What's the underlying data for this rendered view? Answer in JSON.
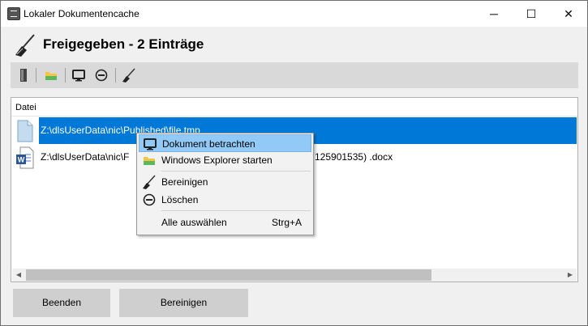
{
  "window": {
    "title": "Lokaler Dokumentencache",
    "minimize_glyph": "─",
    "maximize_glyph": "☐",
    "close_glyph": "✕"
  },
  "heading": {
    "text": "Freigegeben - 2 Einträge",
    "icon": "broom-icon"
  },
  "toolbar": {
    "icons": [
      "exit-door-icon",
      "folder-icon",
      "monitor-icon",
      "remove-circle-icon",
      "broom-icon"
    ]
  },
  "list": {
    "column_header": "Datei",
    "rows": [
      {
        "path": "Z:\\dlsUserData\\nic\\Published\\file.tmp",
        "icon": "generic-file-icon",
        "selected": true
      },
      {
        "path_start": "Z:\\dlsUserData\\nic\\F",
        "path_end": "125901535) .docx",
        "icon": "word-document-icon",
        "selected": false
      }
    ],
    "scroll_left_glyph": "◀",
    "scroll_right_glyph": "▶"
  },
  "buttons": {
    "exit_label": "Beenden",
    "clean_label": "Bereinigen"
  },
  "context_menu": {
    "items": [
      {
        "label": "Dokument betrachten",
        "icon": "monitor-icon",
        "highlighted": true
      },
      {
        "label": "Windows Explorer starten",
        "icon": "folder-icon"
      },
      {
        "label": "Bereinigen",
        "icon": "broom-icon"
      },
      {
        "label": "Löschen",
        "icon": "remove-circle-icon"
      },
      {
        "label": "Alle auswählen",
        "shortcut": "Strg+A"
      }
    ]
  },
  "colors": {
    "selection": "#0078d7",
    "menu_highlight": "#91c9f7",
    "toolbar_bg": "#d9d9d9",
    "button_bg": "#cfcfcf"
  }
}
